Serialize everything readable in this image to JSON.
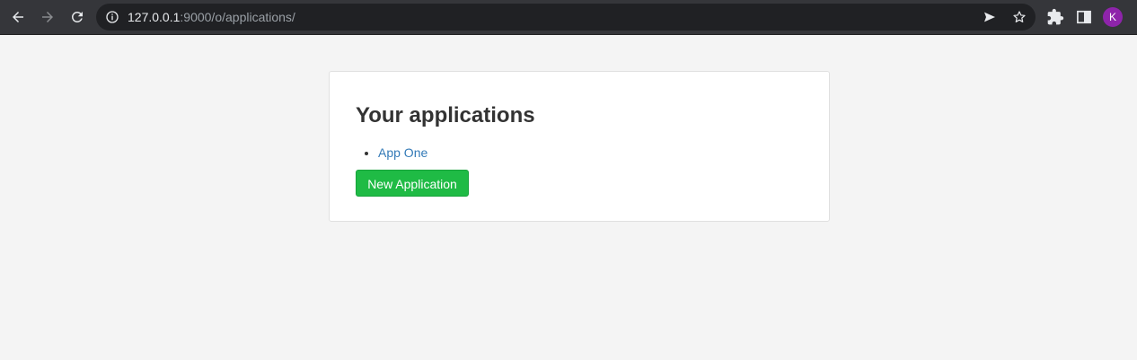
{
  "browser": {
    "url_host": "127.0.0.1",
    "url_rest": ":9000/o/applications/",
    "profile_initial": "K",
    "icons": [
      "back-icon",
      "forward-icon",
      "reload-icon",
      "info-icon",
      "send-icon",
      "star-icon",
      "extensions-icon",
      "side-panel-icon"
    ]
  },
  "page": {
    "heading": "Your applications",
    "applications": [
      "App One"
    ],
    "new_button_label": "New Application"
  }
}
